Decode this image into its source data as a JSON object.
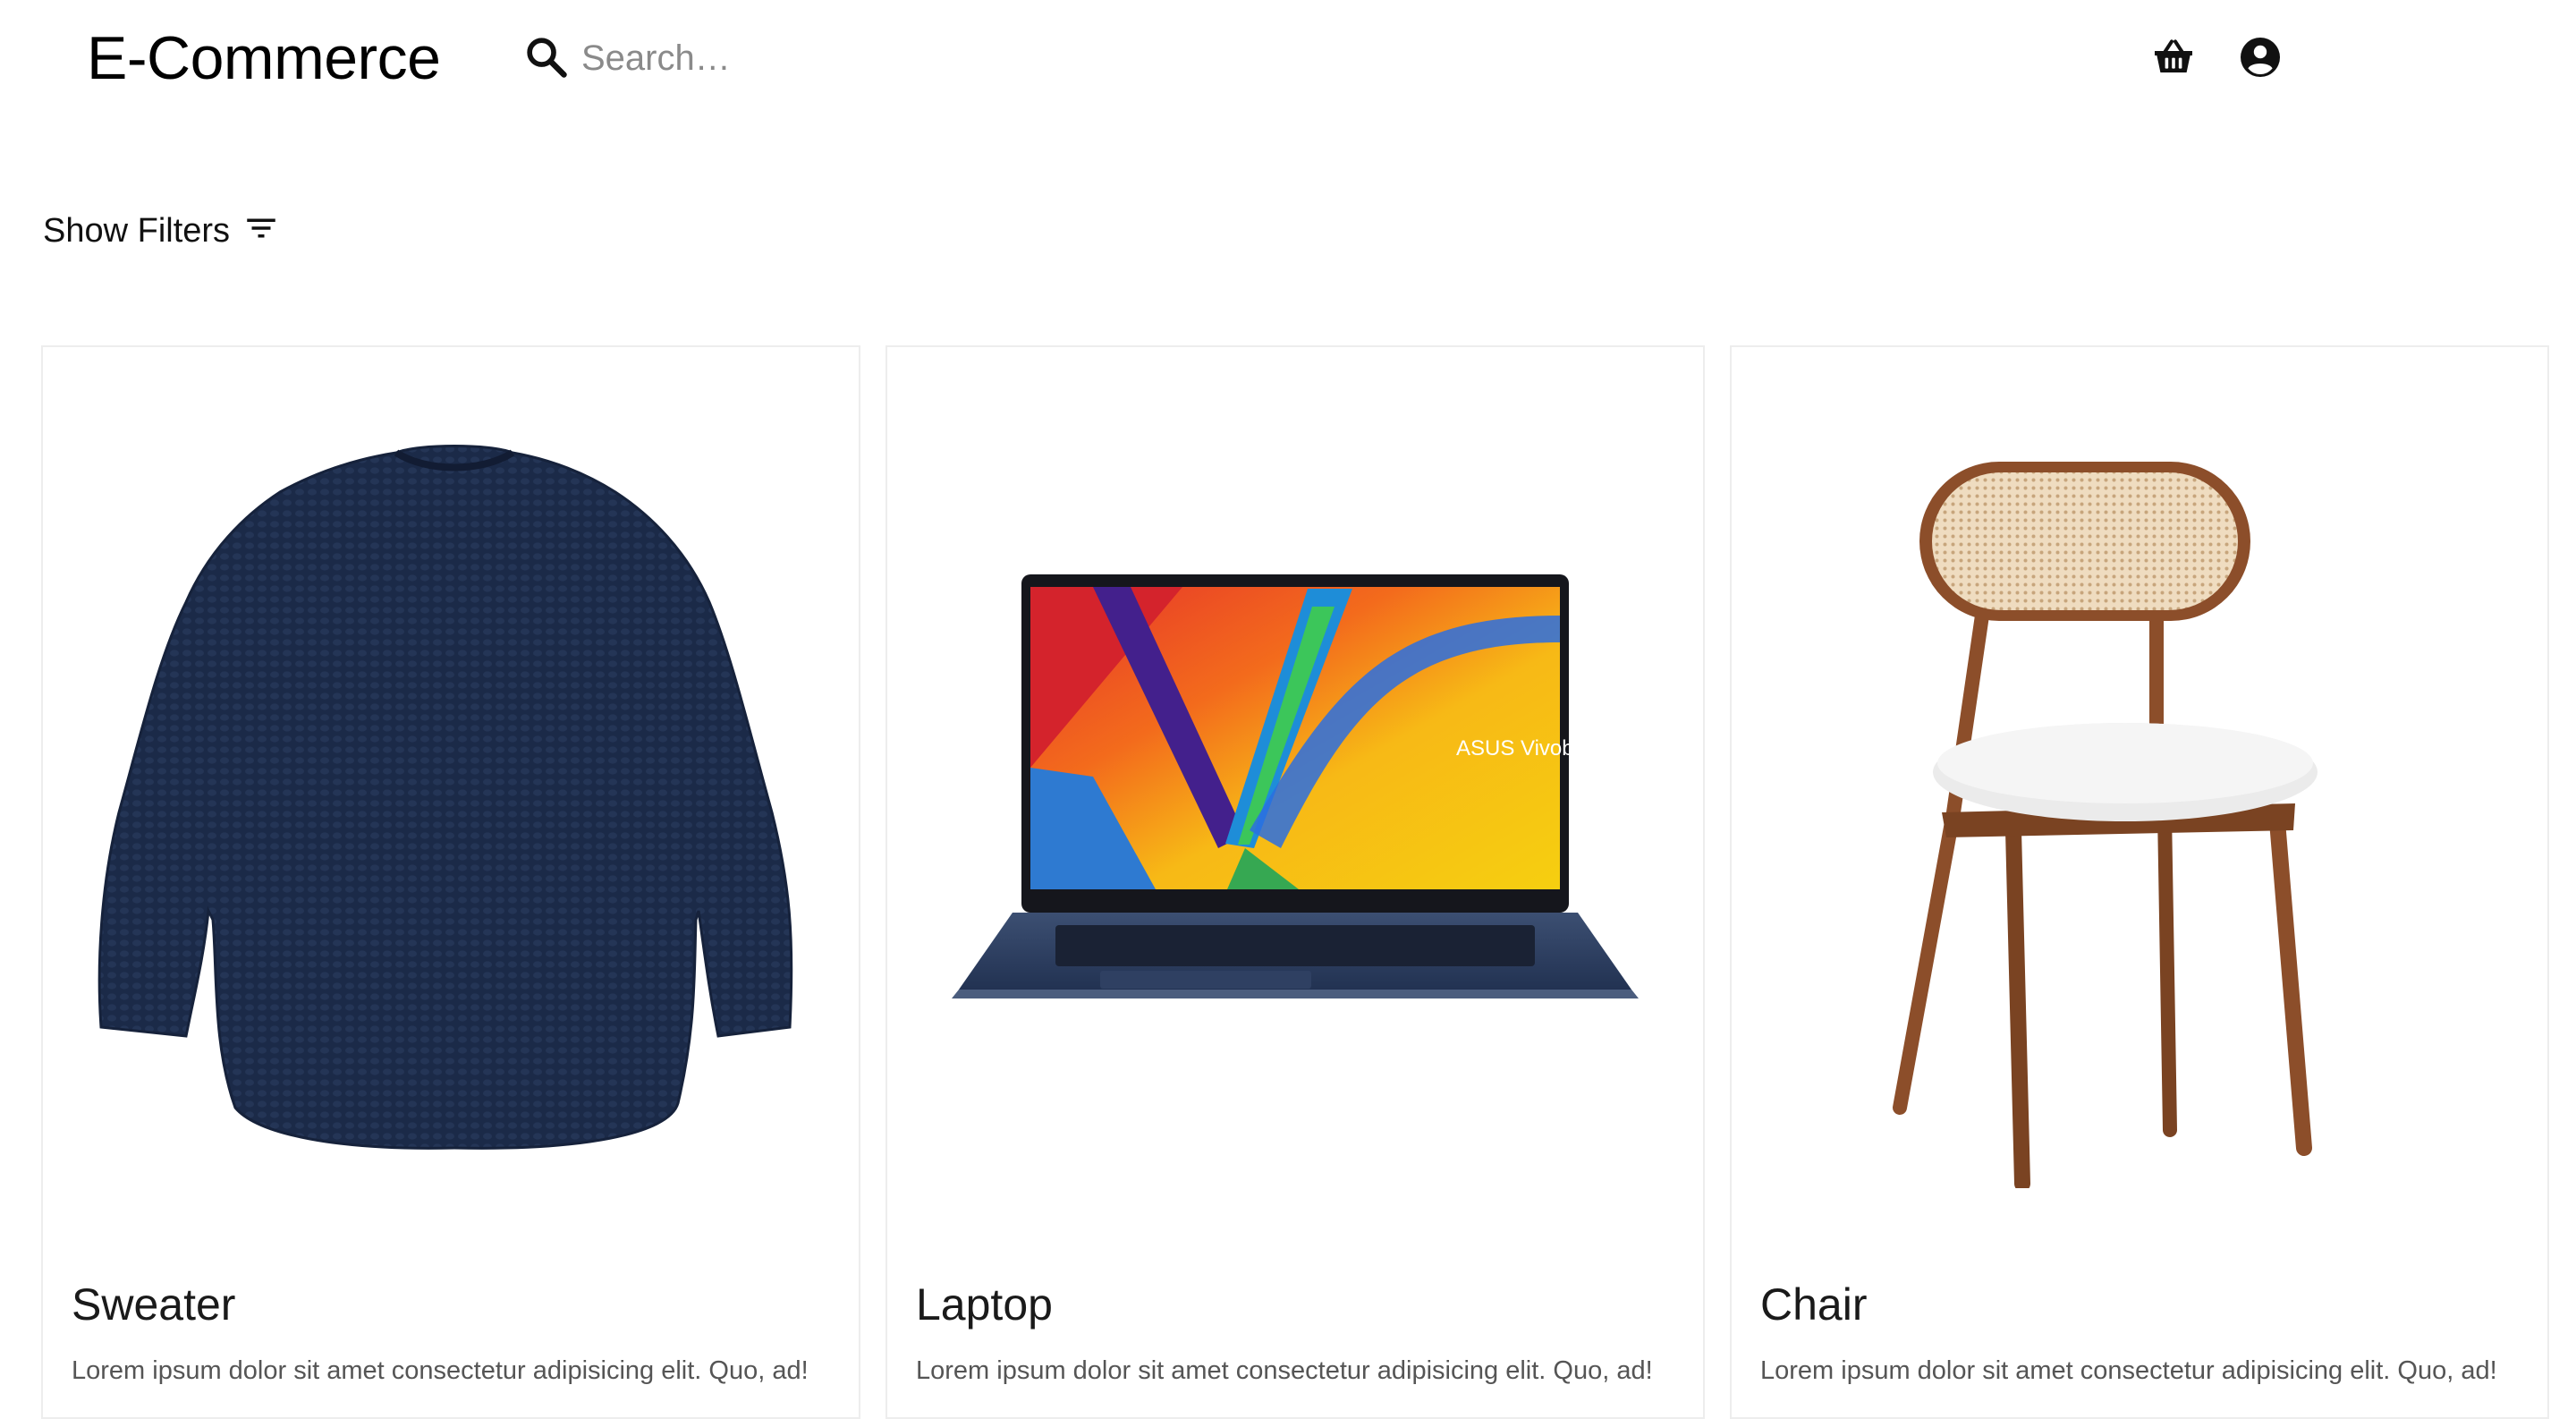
{
  "header": {
    "logo": "E-Commerce",
    "search": {
      "placeholder": "Search…",
      "value": ""
    },
    "icons": [
      "search-icon",
      "basket-icon",
      "account-icon"
    ]
  },
  "filters": {
    "label": "Show Filters",
    "icon": "filter-list-icon"
  },
  "products": [
    {
      "title": "Sweater",
      "description": "Lorem ipsum dolor sit amet consectetur adipisicing elit. Quo, ad!"
    },
    {
      "title": "Laptop",
      "description": "Lorem ipsum dolor sit amet consectetur adipisicing elit. Quo, ad!",
      "image_text": "ASUS Vivobook"
    },
    {
      "title": "Chair",
      "description": "Lorem ipsum dolor sit amet consectetur adipisicing elit. Quo, ad!"
    }
  ],
  "colors": {
    "accent": "#000000",
    "card_border": "#ededed",
    "text_muted": "#555555"
  }
}
